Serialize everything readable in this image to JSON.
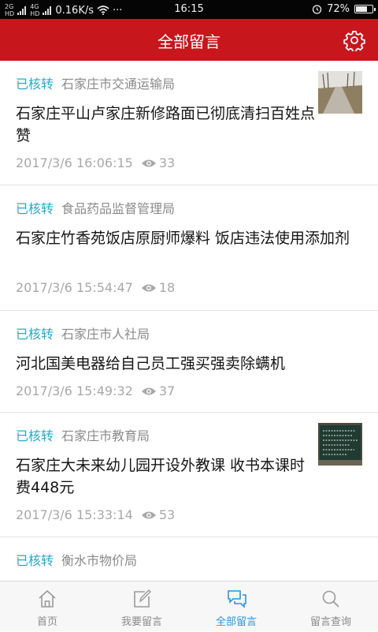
{
  "status_bar": {
    "net_speed": "0.16K/s",
    "more": "···",
    "time": "16:15",
    "battery": "72%",
    "battery_level": 0.72,
    "signal1_top": "2G",
    "signal1_bottom": "HD",
    "signal2_top": "4G",
    "signal2_bottom": "HD"
  },
  "header": {
    "title": "全部留言",
    "settings_icon": "gear-icon",
    "background": "#c8161d"
  },
  "messages": [
    {
      "status": "已核转",
      "department": "石家庄市交通运输局",
      "title": "石家庄平山卢家庄新修路面已彻底清扫百姓点赞",
      "time": "2017/3/6 16:06:15",
      "views": "33",
      "thumbnail": "road-photo"
    },
    {
      "status": "已核转",
      "department": "食品药品监督管理局",
      "title": "石家庄竹香苑饭店原厨师爆料 饭店违法使用添加剂",
      "time": "2017/3/6 15:54:47",
      "views": "18"
    },
    {
      "status": "已核转",
      "department": "石家庄市人社局",
      "title": "河北国美电器给自己员工强买强卖除螨机",
      "time": "2017/3/6 15:49:32",
      "views": "37"
    },
    {
      "status": "已核转",
      "department": "石家庄市教育局",
      "title": "石家庄大未来幼儿园开设外教课 收书本课时费448元",
      "time": "2017/3/6 15:33:14",
      "views": "53",
      "thumbnail": "chalkboard-photo"
    },
    {
      "status": "已核转",
      "department": "衡水市物价局"
    }
  ],
  "tabs": [
    {
      "label": "首页",
      "icon": "home-icon",
      "active": false
    },
    {
      "label": "我要留言",
      "icon": "compose-icon",
      "active": false
    },
    {
      "label": "全部留言",
      "icon": "chat-bubbles-icon",
      "active": true
    },
    {
      "label": "留言查询",
      "icon": "search-icon",
      "active": false
    }
  ],
  "colors": {
    "accent_red": "#c8161d",
    "status_blue": "#2aa7c9",
    "tab_active": "#2a96d6"
  }
}
